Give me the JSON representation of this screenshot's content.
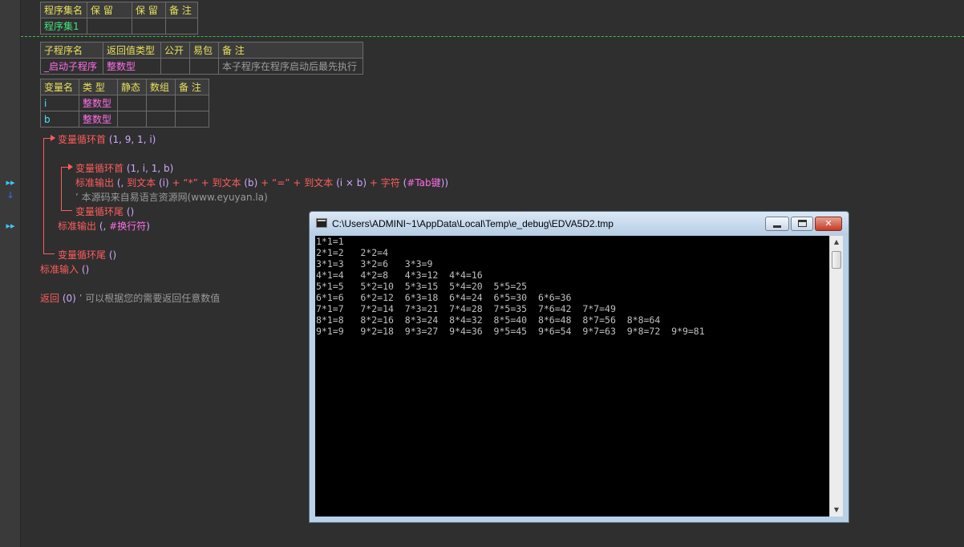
{
  "assembly_table": {
    "headers": [
      "程序集名",
      "保 留",
      "保 留",
      "备 注"
    ],
    "row": [
      "程序集1",
      "",
      "",
      ""
    ]
  },
  "sub_table": {
    "headers": [
      "子程序名",
      "返回值类型",
      "公开",
      "易包",
      "备 注"
    ],
    "row": [
      "_启动子程序",
      "整数型",
      "",
      "",
      "本子程序在程序启动后最先执行"
    ]
  },
  "var_table": {
    "headers": [
      "变量名",
      "类 型",
      "静态",
      "数组",
      "备 注"
    ],
    "rows": [
      [
        "i",
        "整数型",
        "",
        "",
        ""
      ],
      [
        "b",
        "整数型",
        "",
        "",
        ""
      ]
    ]
  },
  "code": {
    "line1_kw": "变量循环首",
    "line1_args": "(1, 9, 1, i)",
    "line2_kw": "变量循环首",
    "line2_args": "(1, i, 1, b)",
    "line3_kw": "标准输出",
    "line3_a": "(, ",
    "line3_b": "到文本",
    "line3_c": "(i)",
    "line3_d": " + ",
    "line3_e": "“*”",
    "line3_f": " + ",
    "line3_g": "到文本",
    "line3_h": "(b)",
    "line3_i": " + ",
    "line3_j": "“=”",
    "line3_k": " + ",
    "line3_l": "到文本",
    "line3_m": "(i × b)",
    "line3_n": " + ",
    "line3_o": "字符",
    "line3_p": "(",
    "line3_q": "#Tab键",
    "line3_r": "))",
    "line4_comment": "’ 本源码来自易语言资源网(www.eyuyan.la)",
    "line5_kw": "变量循环尾",
    "line5_args": "()",
    "line6_kw": "标准输出",
    "line6_a": "(, ",
    "line6_b": "#换行符",
    "line6_c": ")",
    "line7_kw": "变量循环尾",
    "line7_args": "()",
    "line8_kw": "标准输入",
    "line8_args": "()",
    "line9_kw": "返回",
    "line9_args": "(0)",
    "line9_comment": "’ 可以根据您的需要返回任意数值"
  },
  "console": {
    "title": "C:\\Users\\ADMINI~1\\AppData\\Local\\Temp\\e_debug\\EDVA5D2.tmp",
    "lines": [
      "1*1=1",
      "2*1=2   2*2=4",
      "3*1=3   3*2=6   3*3=9",
      "4*1=4   4*2=8   4*3=12  4*4=16",
      "5*1=5   5*2=10  5*3=15  5*4=20  5*5=25",
      "6*1=6   6*2=12  6*3=18  6*4=24  6*5=30  6*6=36",
      "7*1=7   7*2=14  7*3=21  7*4=28  7*5=35  7*6=42  7*7=49",
      "8*1=8   8*2=16  8*3=24  8*4=32  8*5=40  8*6=48  8*7=56  8*8=64",
      "9*1=9   9*2=18  9*3=27  9*4=36  9*5=45  9*6=54  9*7=63  9*8=72  9*9=81"
    ]
  }
}
